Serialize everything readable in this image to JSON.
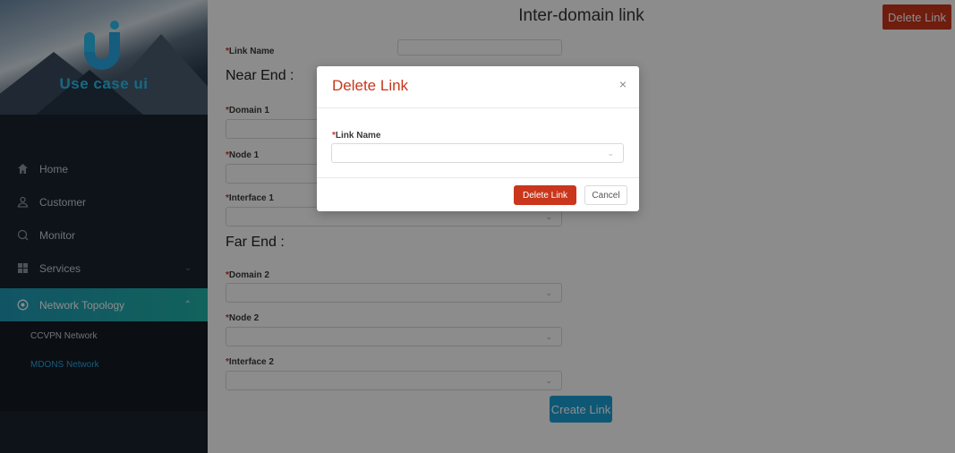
{
  "app": {
    "logo_text": "Use case ui"
  },
  "sidebar": {
    "items": [
      {
        "label": "Home",
        "icon": "home-icon"
      },
      {
        "label": "Customer",
        "icon": "customer-icon"
      },
      {
        "label": "Monitor",
        "icon": "monitor-icon"
      },
      {
        "label": "Services",
        "icon": "services-icon"
      },
      {
        "label": "Network Topology",
        "icon": "network-icon"
      }
    ],
    "sub_items": [
      {
        "label": "CCVPN Network"
      },
      {
        "label": "MDONS Network"
      }
    ]
  },
  "header": {
    "title": "Inter-domain link",
    "delete_button": "Delete Link"
  },
  "form": {
    "required_mark": "*",
    "link_name_label": "Link Name",
    "near_end_title": "Near End :",
    "domain1_label": "Domain 1",
    "node1_label": "Node 1",
    "interface1_label": "Interface 1",
    "far_end_title": "Far End :",
    "domain2_label": "Domain 2",
    "node2_label": "Node 2",
    "interface2_label": "Interface 2",
    "create_button": "Create Link"
  },
  "modal": {
    "title": "Delete Link",
    "close_icon": "×",
    "required_mark": "*",
    "field_label": "Link Name",
    "field_value": "",
    "delete_button": "Delete Link",
    "cancel_button": "Cancel"
  },
  "colors": {
    "accent_red": "#c9361c",
    "accent_blue": "#1aa1d6",
    "sidebar_bg": "#1b2430",
    "active_teal": "#21b3a9"
  }
}
